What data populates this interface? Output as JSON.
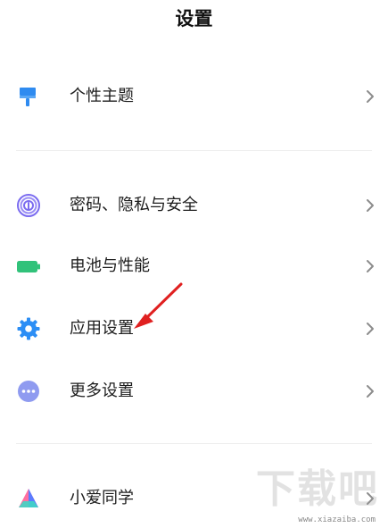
{
  "header": {
    "title": "设置"
  },
  "sections": [
    {
      "items": [
        {
          "label": "个性主题",
          "icon": "paint-brush-icon"
        }
      ]
    },
    {
      "items": [
        {
          "label": "密码、隐私与安全",
          "icon": "fingerprint-icon"
        },
        {
          "label": "电池与性能",
          "icon": "battery-icon"
        },
        {
          "label": "应用设置",
          "icon": "gear-icon"
        },
        {
          "label": "更多设置",
          "icon": "more-dots-icon"
        }
      ]
    },
    {
      "items": [
        {
          "label": "小爱同学",
          "icon": "xiaoai-icon"
        }
      ]
    }
  ],
  "colors": {
    "brush": "#2f8bf0",
    "fingerprint": "#7b6cf0",
    "battery": "#31c27a",
    "gear": "#2c8ef5",
    "more": "#8f9bf0",
    "arrow": "#e02020"
  },
  "watermark": {
    "brand": "下载吧",
    "url": "www.xiazaiba.com"
  }
}
